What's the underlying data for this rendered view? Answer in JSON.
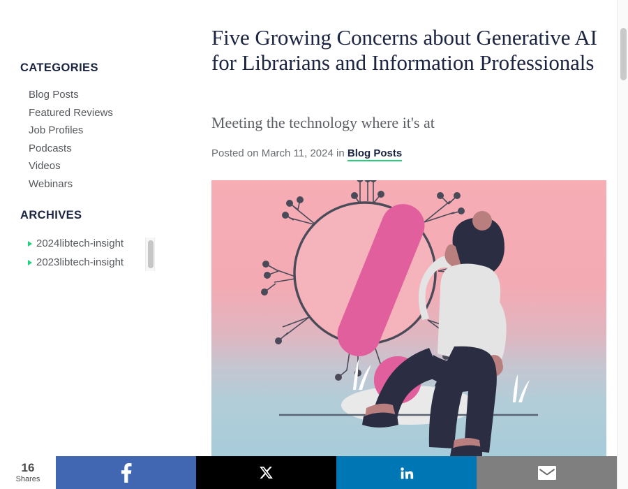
{
  "sidebar": {
    "categories": {
      "heading": "CATEGORIES",
      "items": [
        {
          "label": "Blog Posts"
        },
        {
          "label": "Featured Reviews"
        },
        {
          "label": "Job Profiles"
        },
        {
          "label": "Podcasts"
        },
        {
          "label": "Videos"
        },
        {
          "label": "Webinars"
        }
      ]
    },
    "archives": {
      "heading": "ARCHIVES",
      "items": [
        {
          "label": "2024libtech-insight"
        },
        {
          "label": "2023libtech-insight"
        }
      ]
    }
  },
  "article": {
    "title": "Five Growing Concerns about Generative AI for Librarians and Information Professionals",
    "subtitle": "Meeting the technology where it's at",
    "meta_prefix": "Posted on March 11, 2024 in ",
    "meta_category_link": "Blog Posts",
    "hero_alt": "Illustration of a person pushing a large pink exclamation mark next to an AI neural-network node"
  },
  "share_bar": {
    "count": "16",
    "count_label": "Shares",
    "buttons": [
      {
        "name": "facebook",
        "icon": "facebook-icon",
        "color": "#4267b2"
      },
      {
        "name": "twitter",
        "icon": "x-twitter-icon",
        "color": "#000000"
      },
      {
        "name": "linkedin",
        "icon": "linkedin-icon",
        "color": "#0077b5"
      },
      {
        "name": "email",
        "icon": "email-icon",
        "color": "#7f7f7f"
      }
    ]
  },
  "colors": {
    "heading_navy": "#1b2440",
    "body_gray": "#55585c",
    "accent_green": "#21d07a",
    "hero_pink": "#f6adb4",
    "hero_blue": "#a9cdda",
    "mark_pink": "#e05f9c"
  }
}
